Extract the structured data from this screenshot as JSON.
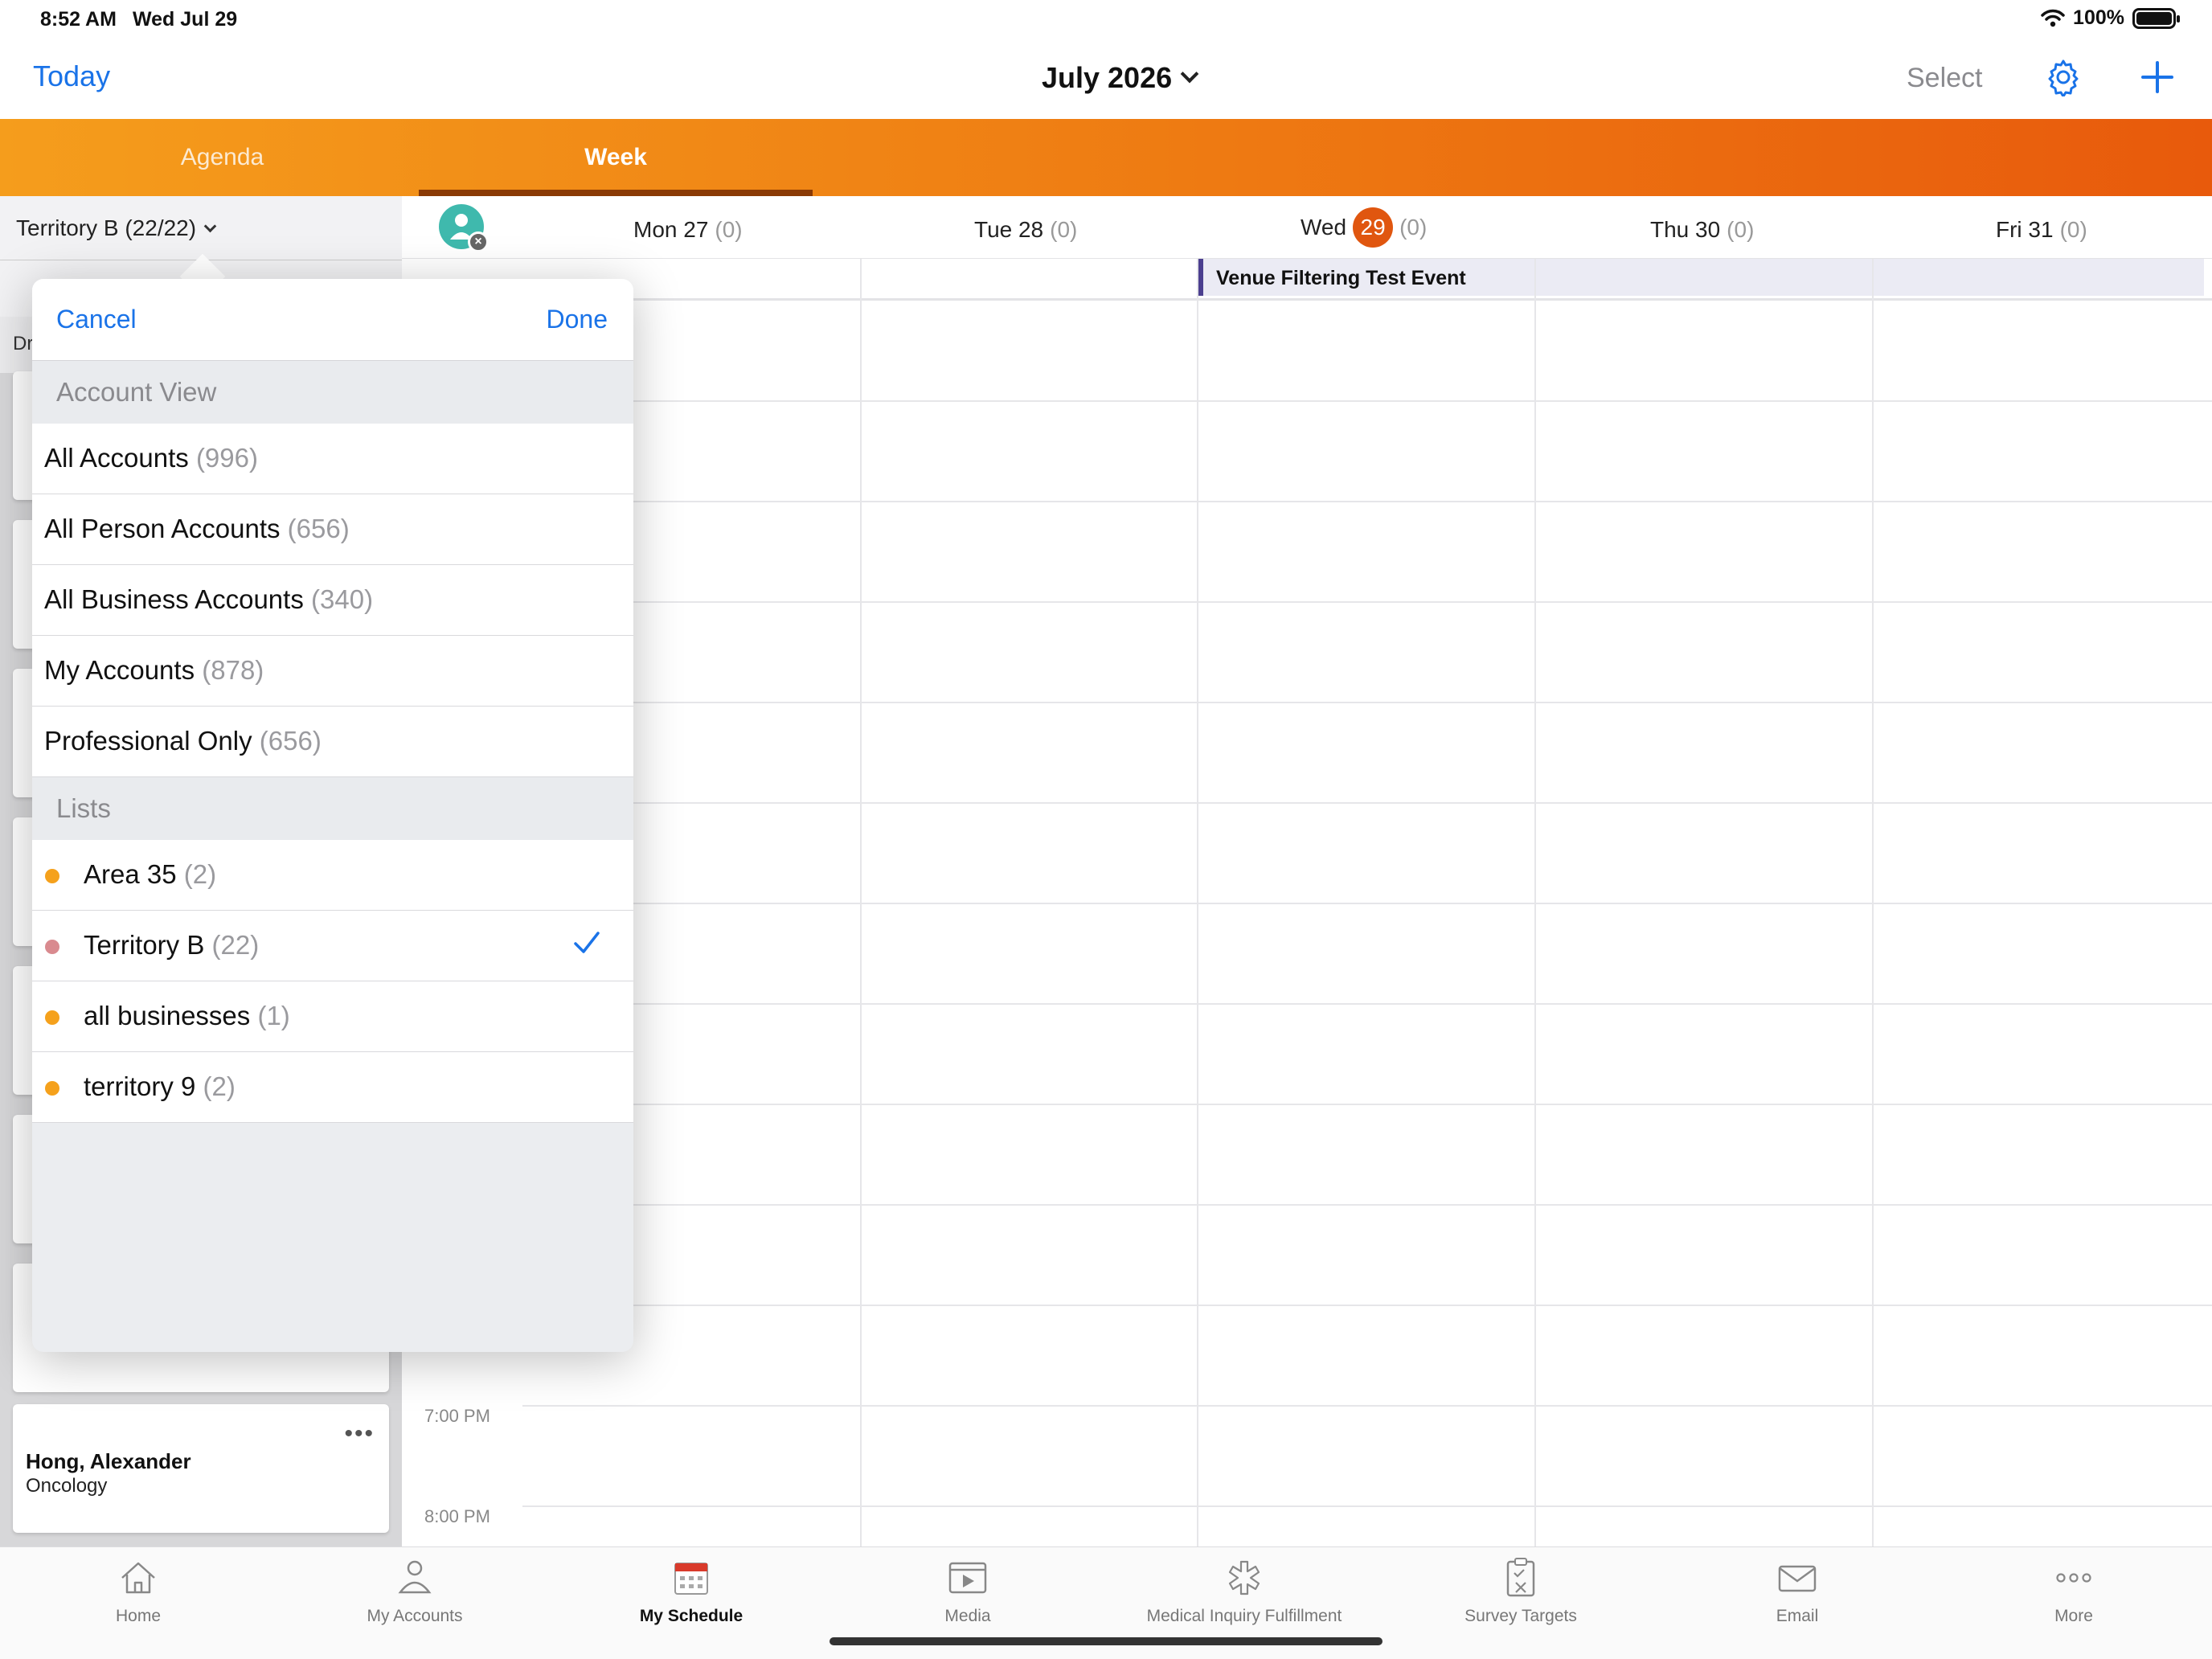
{
  "status": {
    "time": "8:52 AM",
    "date": "Wed Jul 29",
    "battery": "100%"
  },
  "nav": {
    "today": "Today",
    "month": "July 2026",
    "select": "Select"
  },
  "tabs": {
    "agenda": "Agenda",
    "week": "Week"
  },
  "left": {
    "territory": "Territory B (22/22)",
    "sub_prefix": "Dr",
    "cards": [
      {
        "name": "Hong, Alexander",
        "sub": "Oncology"
      }
    ]
  },
  "calendar": {
    "days": [
      {
        "label": "Mon 27",
        "count": "(0)"
      },
      {
        "label": "Tue 28",
        "count": "(0)"
      },
      {
        "label": "Wed",
        "num": "29",
        "count": "(0)"
      },
      {
        "label": "Thu 30",
        "count": "(0)"
      },
      {
        "label": "Fri 31",
        "count": "(0)"
      }
    ],
    "event": "Venue Filtering Test Event",
    "times": [
      "7:00 PM",
      "8:00 PM"
    ]
  },
  "dropdown": {
    "cancel": "Cancel",
    "done": "Done",
    "account_view_label": "Account View",
    "account_views": [
      {
        "label": "All Accounts",
        "count": "(996)"
      },
      {
        "label": "All Person Accounts",
        "count": "(656)"
      },
      {
        "label": "All Business Accounts",
        "count": "(340)"
      },
      {
        "label": "My Accounts",
        "count": "(878)"
      },
      {
        "label": "Professional Only",
        "count": "(656)"
      }
    ],
    "lists_label": "Lists",
    "lists": [
      {
        "label": "Area 35",
        "count": "(2)",
        "color": "#f5a11c"
      },
      {
        "label": "Territory B",
        "count": "(22)",
        "color": "#d98a8f",
        "selected": true
      },
      {
        "label": "all businesses",
        "count": "(1)",
        "color": "#f5a11c"
      },
      {
        "label": "territory 9",
        "count": "(2)",
        "color": "#f5a11c"
      }
    ]
  },
  "bottom_tabs": [
    {
      "label": "Home",
      "icon": "home-icon"
    },
    {
      "label": "My Accounts",
      "icon": "person-icon"
    },
    {
      "label": "My Schedule",
      "icon": "calendar-icon",
      "active": true
    },
    {
      "label": "Media",
      "icon": "media-icon"
    },
    {
      "label": "Medical Inquiry Fulfillment",
      "icon": "medical-icon"
    },
    {
      "label": "Survey Targets",
      "icon": "clipboard-icon"
    },
    {
      "label": "Email",
      "icon": "email-icon"
    },
    {
      "label": "More",
      "icon": "more-icon"
    }
  ],
  "colors": {
    "accent": "#1a73e8",
    "brand_orange": "#ee7a12",
    "today_badge": "#e0560f",
    "event_bar": "#4b3f8f"
  }
}
